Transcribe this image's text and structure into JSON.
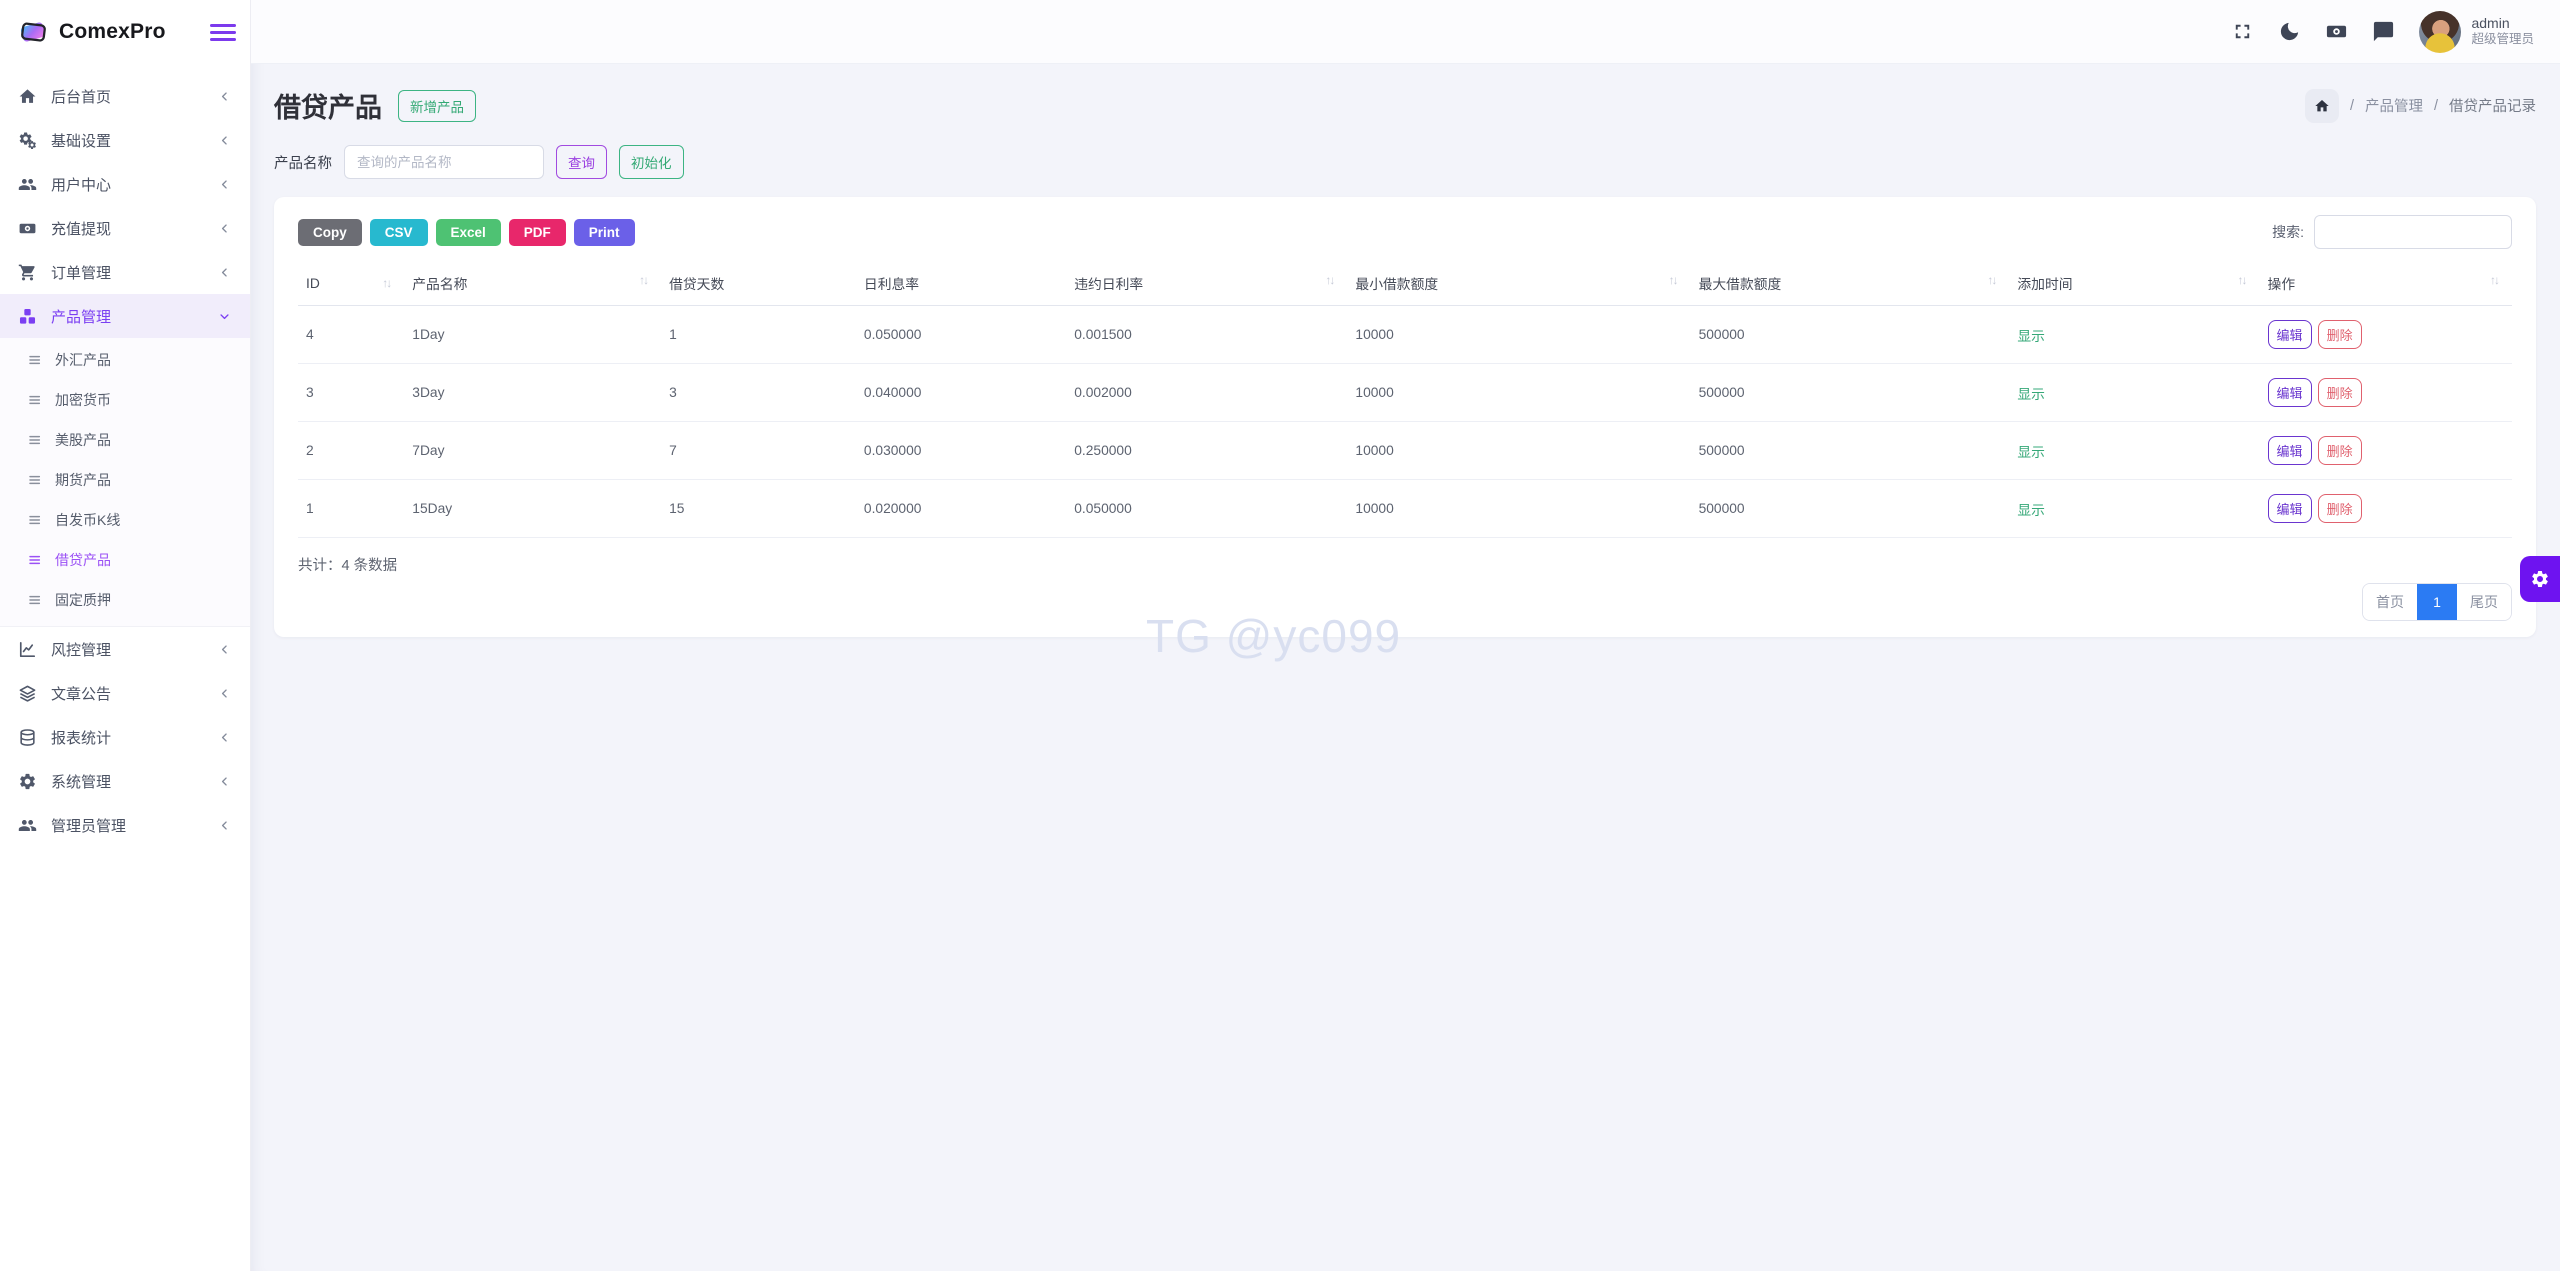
{
  "app": {
    "brand": "ComexPro"
  },
  "topbar": {
    "user": {
      "name": "admin",
      "role": "超级管理员"
    }
  },
  "breadcrumb": {
    "sep": "/",
    "items": [
      "产品管理",
      "借贷产品记录"
    ]
  },
  "sidebar": {
    "items": [
      {
        "label": "后台首页"
      },
      {
        "label": "基础设置"
      },
      {
        "label": "用户中心"
      },
      {
        "label": "充值提现"
      },
      {
        "label": "订单管理"
      },
      {
        "label": "产品管理"
      },
      {
        "label": "风控管理"
      },
      {
        "label": "文章公告"
      },
      {
        "label": "报表统计"
      },
      {
        "label": "系统管理"
      },
      {
        "label": "管理员管理"
      }
    ],
    "submenu": [
      {
        "label": "外汇产品"
      },
      {
        "label": "加密货币"
      },
      {
        "label": "美股产品"
      },
      {
        "label": "期货产品"
      },
      {
        "label": "自发币K线"
      },
      {
        "label": "借贷产品"
      },
      {
        "label": "固定质押"
      }
    ]
  },
  "page": {
    "title": "借贷产品",
    "add_button": "新增产品",
    "filter": {
      "label": "产品名称",
      "placeholder": "查询的产品名称",
      "query": "查询",
      "reset": "初始化"
    }
  },
  "toolbar": {
    "export": [
      "Copy",
      "CSV",
      "Excel",
      "PDF",
      "Print"
    ],
    "search_label": "搜索:"
  },
  "table": {
    "columns": [
      "ID",
      "产品名称",
      "借贷天数",
      "日利息率",
      "违约日利率",
      "最小借款额度",
      "最大借款额度",
      "添加时间",
      "操作"
    ],
    "rows": [
      {
        "id": "4",
        "name": "1Day",
        "days": "1",
        "rate": "0.050000",
        "default_rate": "0.001500",
        "min": "10000",
        "max": "500000",
        "time": "显示"
      },
      {
        "id": "3",
        "name": "3Day",
        "days": "3",
        "rate": "0.040000",
        "default_rate": "0.002000",
        "min": "10000",
        "max": "500000",
        "time": "显示"
      },
      {
        "id": "2",
        "name": "7Day",
        "days": "7",
        "rate": "0.030000",
        "default_rate": "0.250000",
        "min": "10000",
        "max": "500000",
        "time": "显示"
      },
      {
        "id": "1",
        "name": "15Day",
        "days": "15",
        "rate": "0.020000",
        "default_rate": "0.050000",
        "min": "10000",
        "max": "500000",
        "time": "显示"
      }
    ],
    "row_actions": {
      "edit": "编辑",
      "delete": "删除"
    },
    "summary": "共计：4 条数据",
    "pagination": {
      "first": "首页",
      "current": "1",
      "last": "尾页"
    }
  },
  "watermark": "TG @yc099",
  "icons": {
    "sort": "↑↓"
  },
  "colors": {
    "primary": "#7b3ff2",
    "pagination_active": "#2b7bf3",
    "export_copy": "#6c6d74",
    "export_csv": "#27b9cf",
    "export_excel": "#4ec273",
    "export_pdf": "#e8276b",
    "export_print": "#6b60e8",
    "success_green": "#35ab76",
    "edit_purple": "#6a35cf",
    "delete_red": "#e0616e",
    "fab_purple": "#6e13f0"
  }
}
